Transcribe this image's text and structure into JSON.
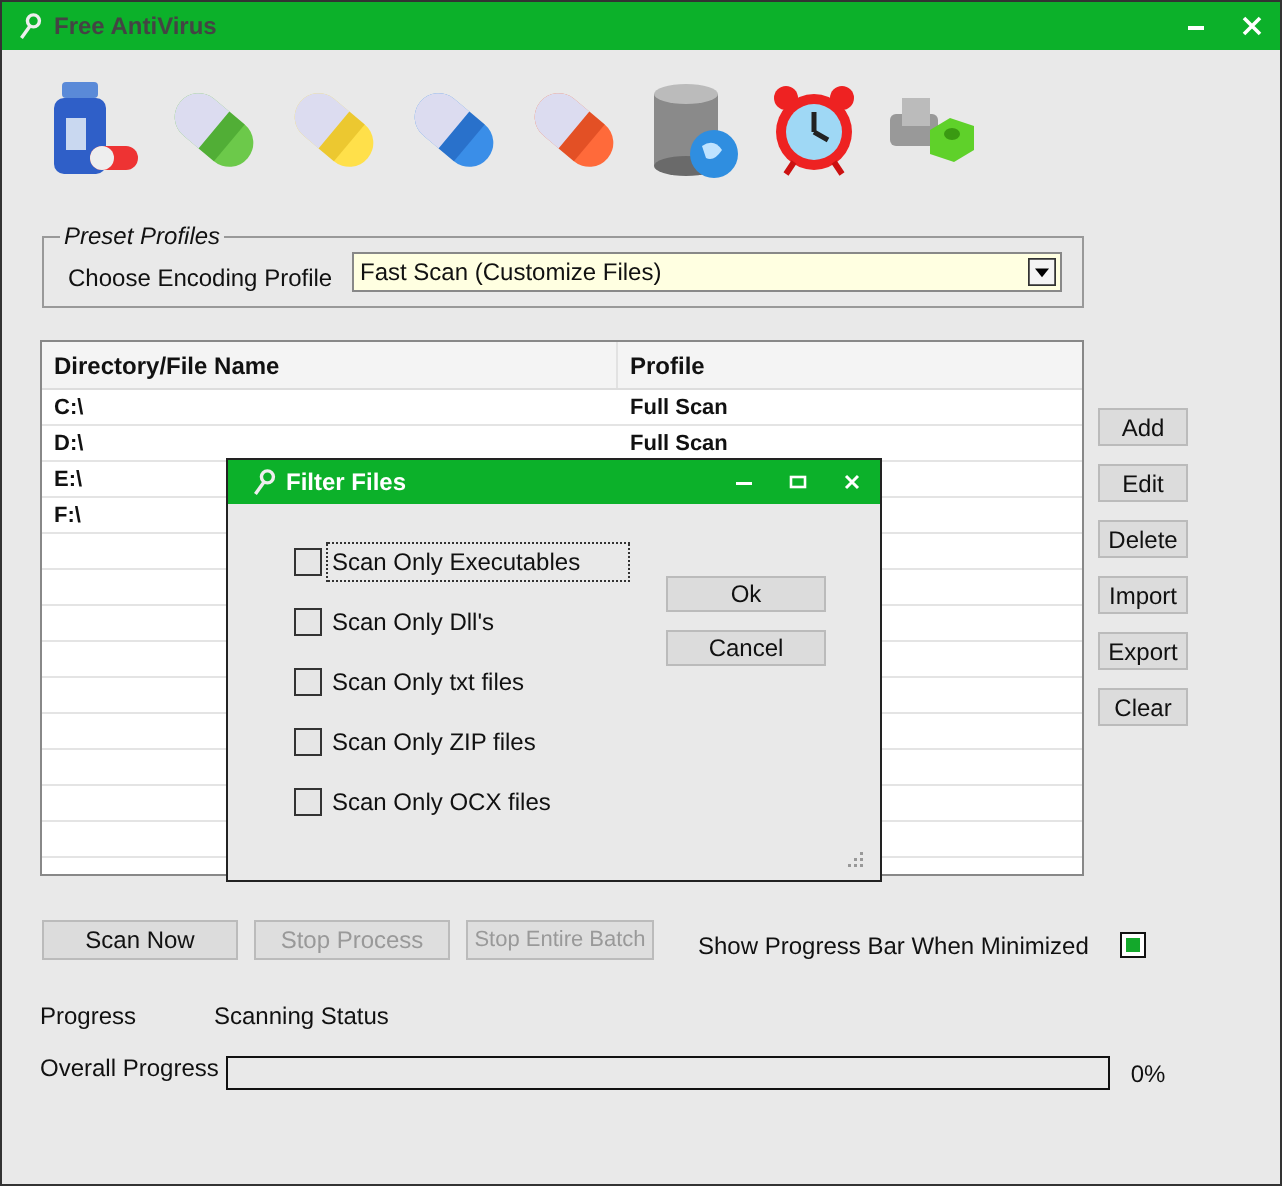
{
  "window": {
    "title": "Free AntiVirus"
  },
  "preset_profiles": {
    "legend": "Preset Profiles",
    "label": "Choose Encoding Profile",
    "value": "Fast Scan (Customize Files)"
  },
  "table": {
    "columns": [
      "Directory/File Name",
      "Profile"
    ],
    "rows": [
      {
        "cells": [
          "C:\\",
          "Full Scan"
        ]
      },
      {
        "cells": [
          "D:\\",
          "Full Scan"
        ]
      },
      {
        "cells": [
          "E:\\"
        ]
      },
      {
        "cells": [
          "F:\\"
        ]
      }
    ]
  },
  "side_buttons": [
    "Add",
    "Edit",
    "Delete",
    "Import",
    "Export",
    "Clear"
  ],
  "dialog": {
    "title": "Filter Files",
    "options": [
      {
        "label": "Scan Only Executables",
        "checked": false,
        "focused": true
      },
      {
        "label": "Scan Only Dll's",
        "checked": false,
        "focused": false
      },
      {
        "label": "Scan Only txt files",
        "checked": false,
        "focused": false
      },
      {
        "label": "Scan Only ZIP files",
        "checked": false,
        "focused": false
      },
      {
        "label": "Scan Only OCX files",
        "checked": false,
        "focused": false
      }
    ],
    "buttons": [
      "Ok",
      "Cancel"
    ]
  },
  "actions": [
    {
      "label": "Scan Now",
      "disabled": false
    },
    {
      "label": "Stop Process",
      "disabled": true
    },
    {
      "label": "Stop Entire Batch",
      "disabled": true
    }
  ],
  "minimized_option": {
    "label": "Show Progress Bar When Minimized",
    "checked": true
  },
  "status": {
    "label": "Progress",
    "value": "Scanning Status"
  },
  "progress": {
    "label": "Overall Progress",
    "level": 0,
    "reading": "0%"
  }
}
